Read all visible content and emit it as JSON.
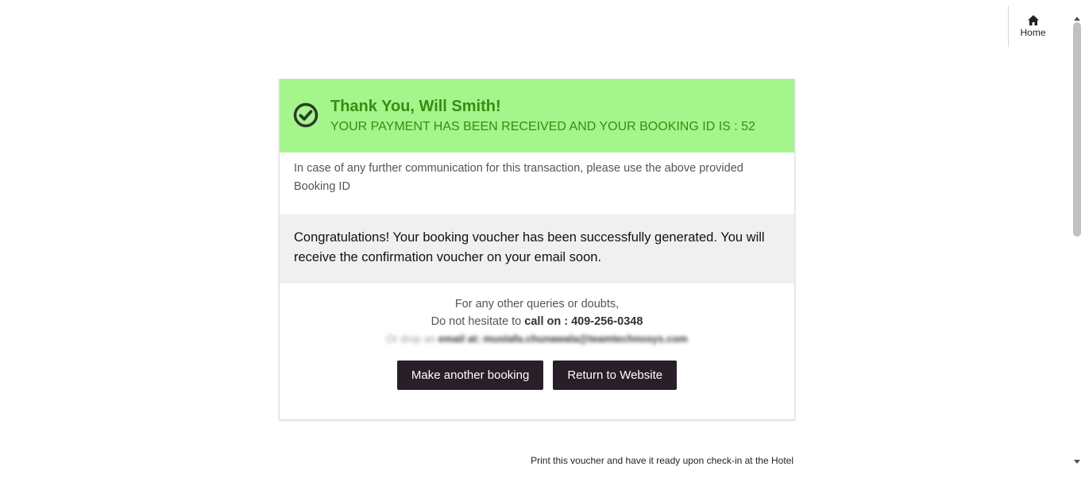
{
  "nav": {
    "home_label": "Home",
    "icon": "home-icon"
  },
  "header": {
    "title": "Thank You, Will Smith!",
    "subtitle": "YOUR PAYMENT HAS BEEN RECEIVED AND YOUR BOOKING ID IS : 52",
    "icon": "check-circle-icon",
    "bg_color": "#a3f58c",
    "text_color": "#3d8a12"
  },
  "info": {
    "text": "In case of any further communication for this transaction, please use the above provided Booking ID"
  },
  "congrats": {
    "text": "Congratulations! Your booking voucher has been successfully generated. You will receive the confirmation voucher on your email soon."
  },
  "contact": {
    "line1": "For any other queries or doubts,",
    "line2_prefix": "Do not hesitate to ",
    "line2_bold": "call on : 409-256-0348",
    "line3_blurred_prefix": "Or drop an ",
    "line3_blurred_bold": "email at: mustafa.chunawala@teamtechnosys.com"
  },
  "buttons": {
    "make_another": "Make another booking",
    "return_website": "Return to Website",
    "bg_color": "#2a1f28"
  },
  "footer": {
    "note": "Print this voucher and have it ready upon check-in at the Hotel"
  }
}
